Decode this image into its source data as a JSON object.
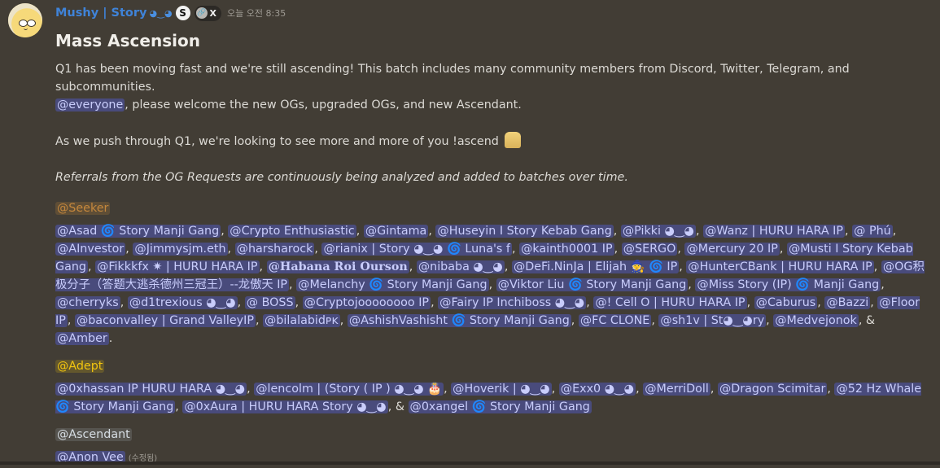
{
  "message": {
    "author": {
      "name": "Mushy | Story",
      "name_emoji": "◕‿◕",
      "badge_letter": "S",
      "tag_icon": "link-icon",
      "tag_text": "X",
      "name_color": "#3f83d8"
    },
    "timestamp": "오늘 오전 8:35",
    "title": "Mass Ascension",
    "intro_line_1": "Q1 has been moving fast and we're still ascending! This batch includes many community members from Discord, Twitter, Telegram, and subcommunities.",
    "everyone_mention": "@everyone",
    "intro_line_2": ", please welcome the new OGs, upgraded OGs, and new Ascendant.",
    "push_line": "As we push through Q1, we're looking to see more and more of you !ascend",
    "referrals_line": "Referrals from the OG Requests are continuously being analyzed and added to batches over time.",
    "edited_label": "(수정됨)"
  },
  "roles": {
    "seeker": {
      "label": "@Seeker",
      "color": "#c4873c"
    },
    "adept": {
      "label": "@Adept",
      "color": "#f1c40f"
    },
    "ascendant": {
      "label": "@Ascendant",
      "color": "#d6dde3"
    }
  },
  "seeker_members": [
    "@Asad 🌀 Story Manji Gang",
    "@Crypto Enthusiastic",
    "@Gintama",
    "@Huseyin I Story Kebab Gang",
    "@Pikki ◕‿◕",
    "@Wanz | HURU HARA IP",
    "@ Phú",
    "@AInvestor",
    "@Jimmysjm.eth",
    "@harsharock",
    "@rianix | Story ◕‿◕ 🌀 Luna's f",
    "@kainth0001 IP",
    "@SERGO",
    "@Mercury 20 IP",
    "@Musti I Story Kebab Gang",
    "@Fikkkfx ✷ | HURU HARA IP",
    "@Habana Roi Ourson",
    "@nibaba ◕‿◕",
    "@DeFi.NinJa | Elijah 🧙 🌀 IP",
    "@HunterCBank | HURU HARA IP",
    "@OG积极分子（答题大逃杀德州三冠王）--龙傲天 IP",
    "@Melanchy 🌀 Story Manji Gang",
    "@Viktor Liu 🌀 Story Manji Gang",
    "@Miss Story (IP) 🌀 Manji Gang",
    "@cherryks",
    "@d1trexious ◕‿◕",
    "@ BOSS",
    "@Cryptojoooooooo IP",
    "@Fairy IP Inchiboss ◕‿◕",
    "@! Cell O | HURU HARA IP",
    "@Caburus",
    "@Bazzi",
    "@Floor IP",
    "@baconvalley | Grand ValleyIP",
    "@bilalabidᴘᴋ",
    "@AshishVashisht 🌀 Story Manji Gang",
    "@FC CLONE",
    "@sh1v | St◕‿◕ry",
    "@Medvejonok",
    "@Amber"
  ],
  "adept_members": [
    "@0xhassan IP HURU HARA ◕‿◕",
    "@lencolm | (Story ( IP ) ◕‿◕ 🎂",
    "@Hoverik | ◕‿◕",
    "@Exx0 ◕‿◕",
    "@MerriDoll",
    "@Dragon Scimitar",
    "@52 Hz Whale 🌀 Story Manji Gang",
    "@0xAura | HURU HARA Story ◕‿◕",
    "@0xangel 🌀 Story Manji Gang"
  ],
  "ascendant_members": [
    "@Anon Vee"
  ],
  "separator": ", ",
  "last_separator": ", & ",
  "terminator": "."
}
